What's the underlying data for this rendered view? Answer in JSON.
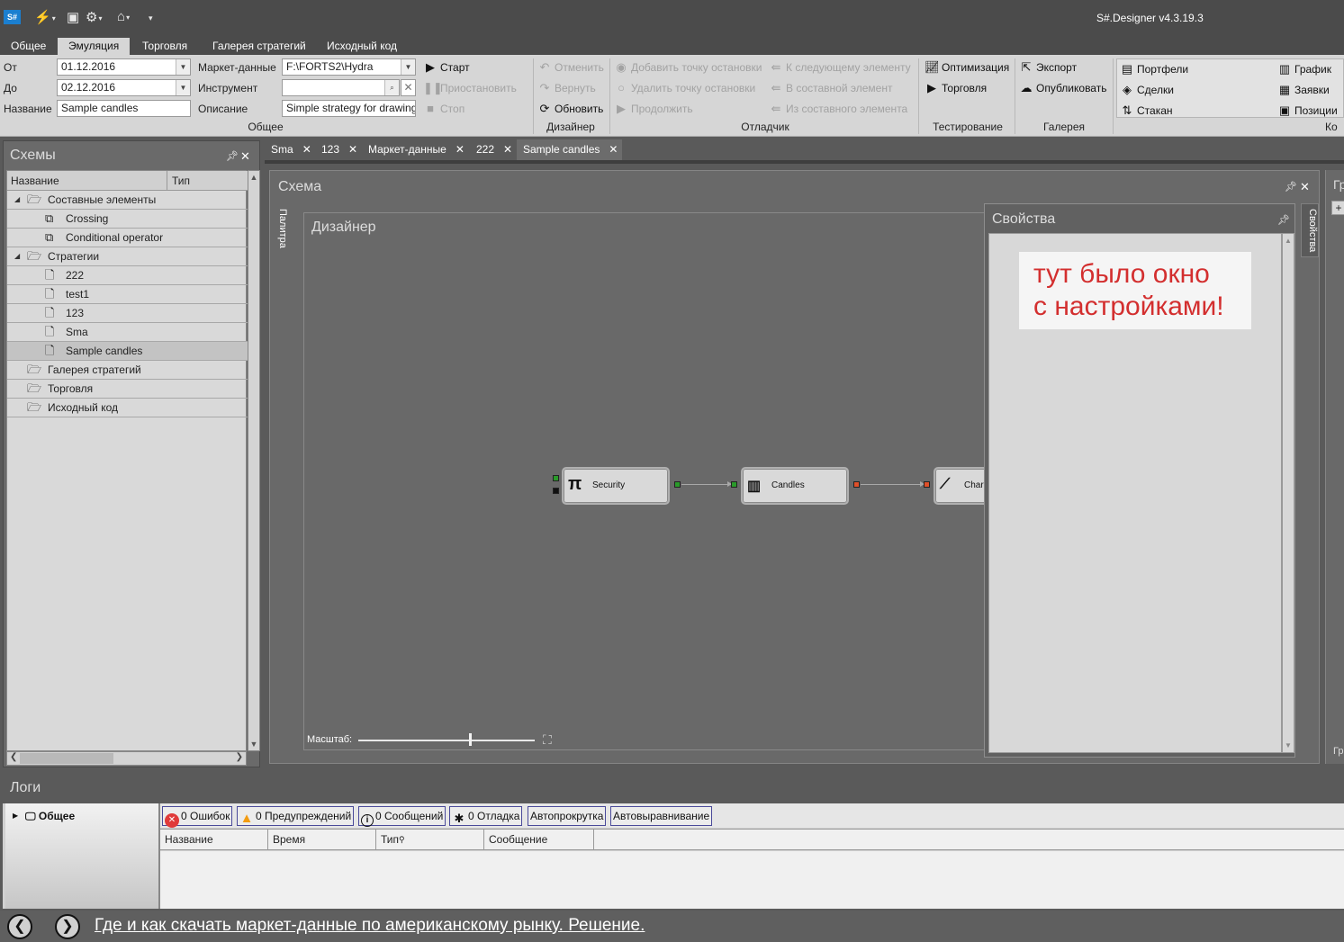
{
  "app": {
    "logo": "S#",
    "title": "S#.Designer v4.3.19.3"
  },
  "ribbon_tabs": [
    "Общее",
    "Эмуляция",
    "Торговля",
    "Галерея стратегий",
    "Исходный код"
  ],
  "active_ribbon_tab": "Эмуляция",
  "general": {
    "from_label": "От",
    "from_value": "01.12.2016",
    "to_label": "До",
    "to_value": "02.12.2016",
    "name_label": "Название",
    "name_value": "Sample candles",
    "market_data_label": "Маркет-данные",
    "market_data_value": "F:\\FORTS2\\Hydra",
    "instrument_label": "Инструмент",
    "instrument_value": "",
    "description_label": "Описание",
    "description_value": "Simple strategy for drawing",
    "group_label": "Общее"
  },
  "run": {
    "start": "Старт",
    "pause": "Приостановить",
    "stop": "Стоп"
  },
  "designer_group": {
    "undo": "Отменить",
    "redo": "Вернуть",
    "refresh": "Обновить",
    "group_label": "Дизайнер"
  },
  "debugger": {
    "add_breakpoint": "Добавить точку остановки",
    "remove_breakpoint": "Удалить точку остановки",
    "continue": "Продолжить",
    "next_element": "К следующему элементу",
    "into_composite": "В составной элемент",
    "out_composite": "Из составного элемента",
    "group_label": "Отладчик"
  },
  "testing": {
    "optimization": "Оптимизация",
    "trading": "Торговля",
    "group_label": "Тестирование"
  },
  "gallery": {
    "export": "Экспорт",
    "publish": "Опубликовать",
    "group_label": "Галерея"
  },
  "components": {
    "portfolios": "Портфели",
    "trades": "Сделки",
    "order_book": "Стакан",
    "chart": "График",
    "orders": "Заявки",
    "positions": "Позиции",
    "group_label": "Ко"
  },
  "schemes": {
    "title": "Схемы",
    "col_name": "Название",
    "col_type": "Тип",
    "rows": [
      {
        "label": "Составные элементы",
        "level": 0,
        "kind": "folder",
        "expander": "◢"
      },
      {
        "label": "Crossing",
        "level": 1,
        "kind": "composite"
      },
      {
        "label": "Conditional operator",
        "level": 1,
        "kind": "composite"
      },
      {
        "label": "Стратегии",
        "level": 0,
        "kind": "folder",
        "expander": "◢"
      },
      {
        "label": "222",
        "level": 1,
        "kind": "doc"
      },
      {
        "label": "test1",
        "level": 1,
        "kind": "doc"
      },
      {
        "label": "123",
        "level": 1,
        "kind": "doc"
      },
      {
        "label": "Sma",
        "level": 1,
        "kind": "doc"
      },
      {
        "label": "Sample candles",
        "level": 1,
        "kind": "doc",
        "selected": true
      },
      {
        "label": "Галерея стратегий",
        "level": 0,
        "kind": "folder"
      },
      {
        "label": "Торговля",
        "level": 0,
        "kind": "folder"
      },
      {
        "label": "Исходный код",
        "level": 0,
        "kind": "folder"
      }
    ]
  },
  "doc_tabs": [
    {
      "label": "Sma"
    },
    {
      "label": "123"
    },
    {
      "label": "Маркет-данные"
    },
    {
      "label": "222"
    },
    {
      "label": "Sample candles",
      "active": true
    }
  ],
  "scheme": {
    "title": "Схема",
    "palette_tab": "Палитра",
    "designer_title": "Дизайнер",
    "nodes": [
      {
        "label": "Security",
        "icon": "π"
      },
      {
        "label": "Candles",
        "icon": "candles-icon"
      },
      {
        "label": "Char",
        "icon": "chart-line-icon"
      }
    ],
    "zoom_label": "Масштаб:",
    "zoom_level": 0.63
  },
  "properties": {
    "title": "Свойства",
    "side_tab": "Свойства",
    "note_line1": "тут было окно",
    "note_line2": "с настройками!"
  },
  "right_panel": {
    "top_label": "Гр",
    "bottom_label": "Гр"
  },
  "logs": {
    "title": "Логи",
    "tree_item": "Общее",
    "errors": "0 Ошибок",
    "warnings": "0 Предупреждений",
    "messages": "0 Сообщений",
    "debug": "0 Отладка",
    "autoscroll": "Автопрокрутка",
    "autoalign": "Автовыравнивание",
    "columns": [
      "Название",
      "Время",
      "Тип",
      "Сообщение"
    ]
  },
  "footer": {
    "link": "Где и как скачать маркет-данные по американскому рынку. Решение."
  },
  "colors": {
    "note_text": "#d32f2f",
    "port_green": "#2a9a2a",
    "port_red": "#e0502a",
    "window_bg": "#5a5a5a"
  }
}
